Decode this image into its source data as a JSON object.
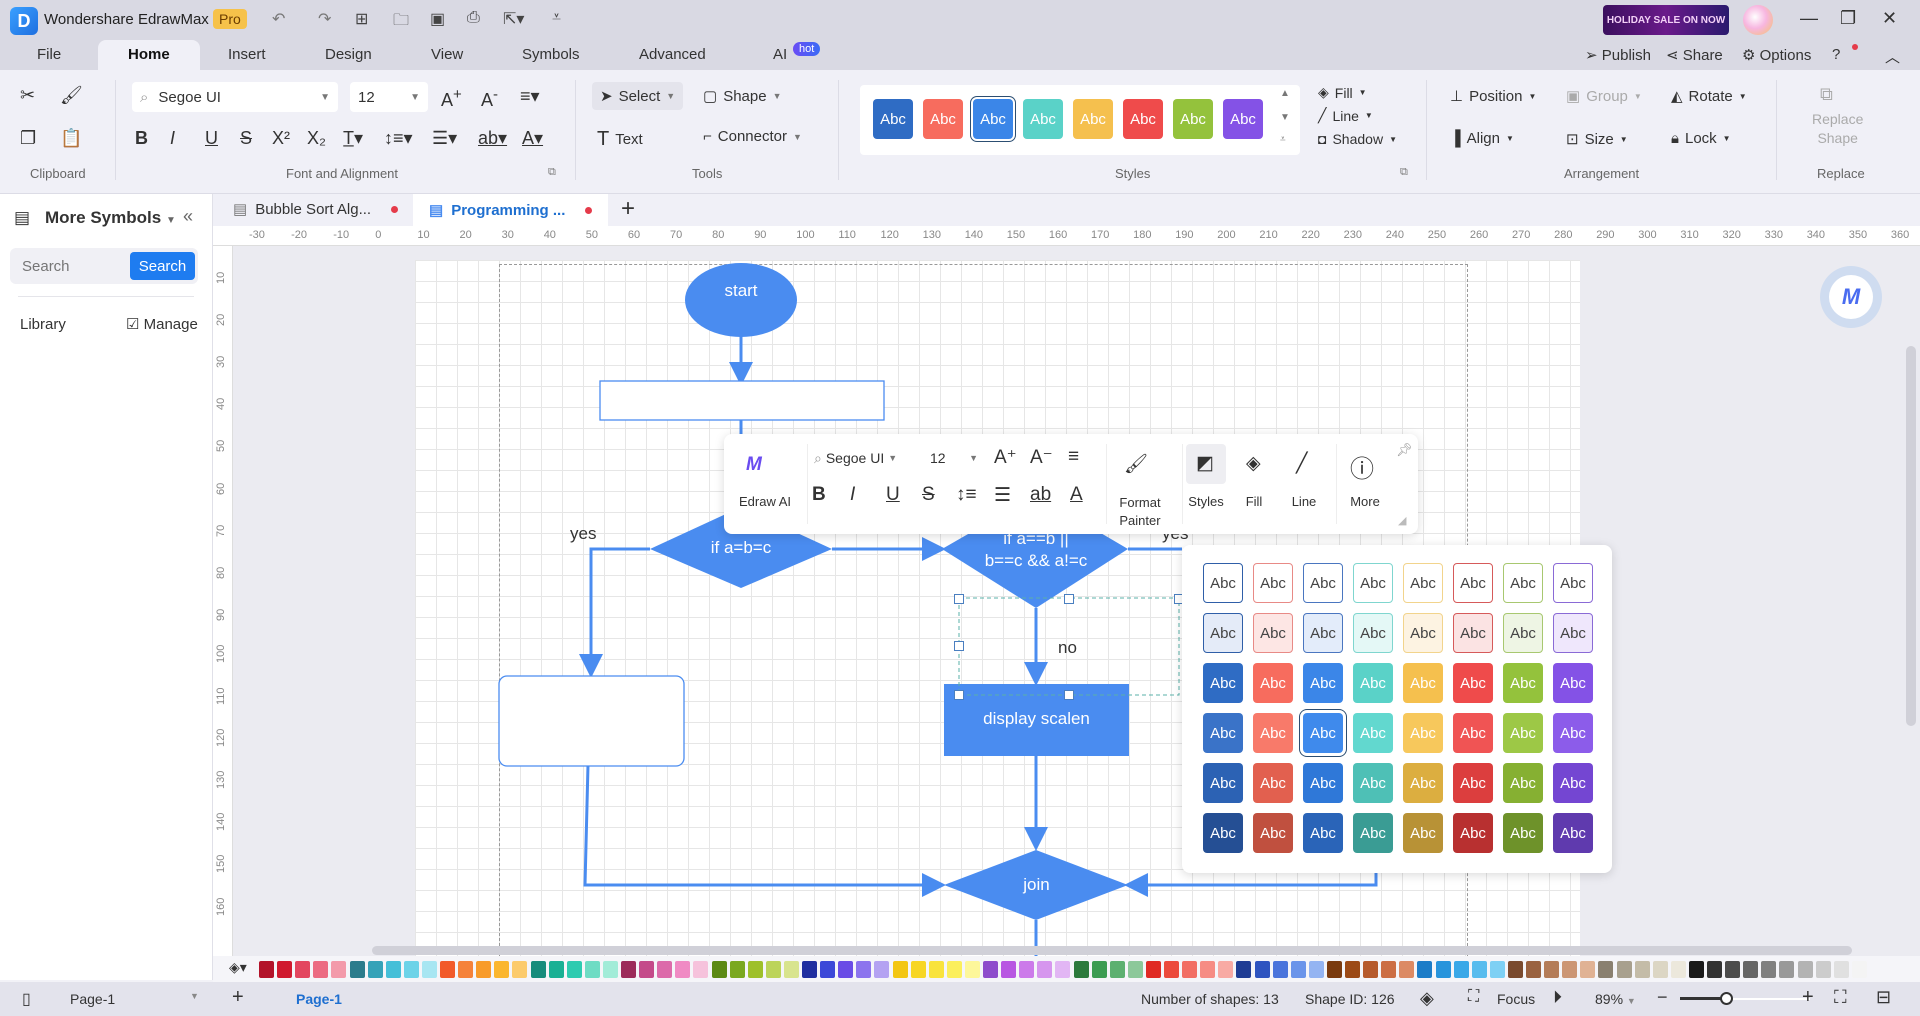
{
  "app": {
    "title": "Wondershare EdrawMax",
    "badge": "Pro",
    "sale_banner": "HOLIDAY SALE ON NOW"
  },
  "menu": {
    "items": [
      "File",
      "Home",
      "Insert",
      "Design",
      "View",
      "Symbols",
      "Advanced",
      "AI"
    ],
    "active": "Home",
    "ai_badge": "hot",
    "right": {
      "publish": "Publish",
      "share": "Share",
      "options": "Options"
    }
  },
  "ribbon": {
    "font": {
      "family": "Segoe UI",
      "size": "12"
    },
    "tools": {
      "select": "Select",
      "shape": "Shape",
      "text": "Text",
      "connector": "Connector"
    },
    "styles_row": [
      {
        "label": "Abc",
        "color": "#2f6cc4"
      },
      {
        "label": "Abc",
        "color": "#f76c5e"
      },
      {
        "label": "Abc",
        "color": "#3b86e8"
      },
      {
        "label": "Abc",
        "color": "#5ad2c8"
      },
      {
        "label": "Abc",
        "color": "#f5c04e"
      },
      {
        "label": "Abc",
        "color": "#ef4b4b"
      },
      {
        "label": "Abc",
        "color": "#94c23c"
      },
      {
        "label": "Abc",
        "color": "#8452e6"
      }
    ],
    "format": {
      "fill": "Fill",
      "line": "Line",
      "shadow": "Shadow"
    },
    "arrangement": {
      "position": "Position",
      "group": "Group",
      "rotate": "Rotate",
      "align": "Align",
      "size": "Size",
      "lock": "Lock"
    },
    "replace": {
      "label_line1": "Replace",
      "label_line2": "Shape"
    },
    "groups": {
      "clipboard": "Clipboard",
      "font": "Font and Alignment",
      "tools": "Tools",
      "styles": "Styles",
      "arrangement": "Arrangement",
      "replace": "Replace"
    }
  },
  "sidebar": {
    "title": "More Symbols",
    "search_placeholder": "Search",
    "search_button": "Search",
    "library": "Library",
    "manage": "Manage"
  },
  "tabs": [
    {
      "label": "Bubble Sort Alg...",
      "active": false,
      "unsaved": true
    },
    {
      "label": "Programming ...",
      "active": true,
      "unsaved": true
    }
  ],
  "rulers": {
    "h": [
      "-30",
      "-20",
      "-10",
      "0",
      "10",
      "20",
      "30",
      "40",
      "50",
      "60",
      "70",
      "80",
      "90",
      "100",
      "110",
      "120",
      "130",
      "140",
      "150",
      "160",
      "170",
      "180",
      "190",
      "200",
      "210",
      "220",
      "230",
      "240",
      "250",
      "260",
      "270",
      "280",
      "290",
      "300",
      "310",
      "320",
      "330",
      "340",
      "350",
      "360"
    ],
    "v": [
      "10",
      "20",
      "30",
      "40",
      "50",
      "60",
      "70",
      "80",
      "90",
      "100",
      "110",
      "120",
      "130",
      "140",
      "150",
      "160"
    ]
  },
  "diagram": {
    "start": "start",
    "decision1": "if a=b=c",
    "decision2_line1": "if a==b ||",
    "decision2_line2": "b==c && a!=c",
    "yes1": "yes",
    "yes2": "yes",
    "no": "no",
    "process": "display scalen",
    "join": "join",
    "shape_color": "#4a8cf0"
  },
  "floating_toolbar": {
    "edraw_ai": "Edraw AI",
    "font": "Segoe UI",
    "size": "12",
    "format_painter_1": "Format",
    "format_painter_2": "Painter",
    "styles": "Styles",
    "fill": "Fill",
    "line": "Line",
    "more": "More"
  },
  "style_popup": {
    "label": "Abc",
    "rows": [
      {
        "kind": "outline",
        "colors": [
          "#2f5fa8",
          "#e88a86",
          "#4a76c0",
          "#7fd6cf",
          "#f2d48c",
          "#d65a5a",
          "#a8c870",
          "#8a6ad6"
        ],
        "fills": [
          "#ffffff",
          "#ffffff",
          "#ffffff",
          "#ffffff",
          "#ffffff",
          "#ffffff",
          "#ffffff",
          "#ffffff"
        ]
      },
      {
        "kind": "light",
        "colors": [
          "#2f5fa8",
          "#e88a86",
          "#4a76c0",
          "#7fd6cf",
          "#f2d48c",
          "#d65a5a",
          "#a8c870",
          "#8a6ad6"
        ],
        "fills": [
          "#e4ebf8",
          "#fde6e4",
          "#e3ecfa",
          "#e4f8f6",
          "#fdf3e2",
          "#fbe3e3",
          "#eef5e4",
          "#efe7fc"
        ]
      },
      {
        "kind": "solid",
        "fills": [
          "#2f6cc4",
          "#f76c5e",
          "#3b86e8",
          "#5ad2c8",
          "#f5c04e",
          "#ef4b4b",
          "#94c23c",
          "#8452e6"
        ]
      },
      {
        "kind": "solid",
        "fills": [
          "#3a73c8",
          "#f87a6a",
          "#3f8aec",
          "#62d8cf",
          "#f7c85c",
          "#f05454",
          "#9dc846",
          "#8c5cea"
        ]
      },
      {
        "kind": "solid",
        "fills": [
          "#2c62b4",
          "#e2604f",
          "#2f78d8",
          "#4ec0b6",
          "#dcae40",
          "#dc3e3e",
          "#86b032",
          "#7446d2"
        ]
      },
      {
        "kind": "solid",
        "fills": [
          "#254f94",
          "#c0503f",
          "#2a64b8",
          "#3a9c94",
          "#b89236",
          "#b83030",
          "#6e922a",
          "#5f3aae"
        ]
      }
    ],
    "selected_row": 3,
    "selected_col": 2
  },
  "palette": [
    "#b3132a",
    "#d0192f",
    "#e3465f",
    "#ec6b82",
    "#f39aaa",
    "#2b7c8c",
    "#35a2b8",
    "#45bfd8",
    "#6dd3e8",
    "#a8e6f2",
    "#f25a2a",
    "#f5823a",
    "#f89b2a",
    "#fbb62e",
    "#fccb6c",
    "#168c7c",
    "#19b094",
    "#2dcbb0",
    "#6edcc4",
    "#a2ecd8",
    "#9c2b5a",
    "#c44a8a",
    "#dc6aaa",
    "#f08ac4",
    "#f6c2dc",
    "#5c8a14",
    "#7aa820",
    "#9ec02a",
    "#bcd45a",
    "#d8e48e",
    "#1f2ea0",
    "#3c48d8",
    "#6a4ce6",
    "#8c74ee",
    "#b4a2f2",
    "#f3c612",
    "#f7d624",
    "#f9e33c",
    "#fbef5c",
    "#fdf79a",
    "#8e4ccc",
    "#b856e2",
    "#cc7aea",
    "#d696ee",
    "#e2b6f4",
    "#2c7a3c",
    "#3c9c52",
    "#5cb070",
    "#8cc89a",
    "#e02a24",
    "#ec4a3c",
    "#f26e64",
    "#f68c84",
    "#f8aaa4",
    "#1f3c94",
    "#2e54c0",
    "#4a74dc",
    "#6a94ea",
    "#94b4f2",
    "#7a3a0e",
    "#9c4a16",
    "#b65a2c",
    "#cc6e44",
    "#dc8a64",
    "#1c7cc8",
    "#2894dc",
    "#3aa8e8",
    "#58bcee",
    "#7ed0f4",
    "#7a4a2e",
    "#9a6240",
    "#b47c58",
    "#cc9674",
    "#e0b294",
    "#8a8070",
    "#a8a08e",
    "#c4bca8",
    "#dcd6c4",
    "#ece8dc",
    "#1a1a1a",
    "#333333",
    "#4c4c4c",
    "#666666",
    "#808080",
    "#999999",
    "#b3b3b3",
    "#cccccc",
    "#e0e0e0",
    "#f4f4f4"
  ],
  "status": {
    "page_selector": "Page-1",
    "page_tab": "Page-1",
    "shapes": "Number of shapes: 13",
    "shape_id": "Shape ID: 126",
    "focus": "Focus",
    "zoom": "89%",
    "zoom_level": 0.35
  }
}
